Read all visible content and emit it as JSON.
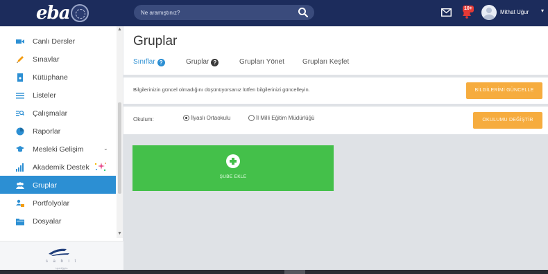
{
  "topbar": {
    "logo_text": "eba",
    "search_placeholder": "Ne aramıştınız?",
    "notification_badge": "10+",
    "username": "Mithat Uğur",
    "icons": [
      "search-icon",
      "mail-icon",
      "bell-icon",
      "avatar",
      "chevron-down-icon"
    ]
  },
  "sidebar": {
    "items": [
      {
        "label": "Canlı Dersler",
        "icon": "video-camera-icon",
        "color": "#2c8fd3"
      },
      {
        "label": "Sınavlar",
        "icon": "pencil-icon",
        "color": "#f39c12"
      },
      {
        "label": "Kütüphane",
        "icon": "book-icon",
        "color": "#2c8fd3"
      },
      {
        "label": "Listeler",
        "icon": "list-icon",
        "color": "#2c8fd3"
      },
      {
        "label": "Çalışmalar",
        "icon": "search-list-icon",
        "color": "#2c8fd3"
      },
      {
        "label": "Raporlar",
        "icon": "pie-chart-icon",
        "color": "#2c8fd3"
      },
      {
        "label": "Mesleki Gelişim",
        "icon": "graduation-cap-icon",
        "color": "#2c8fd3"
      },
      {
        "label": "Akademik Destek",
        "icon": "bar-chart-icon",
        "color": "#2c8fd3"
      },
      {
        "label": "Gruplar",
        "icon": "users-icon",
        "color": "#ffffff"
      },
      {
        "label": "Portfolyolar",
        "icon": "user-folder-icon",
        "color": "#2c8fd3"
      },
      {
        "label": "Dosyalar",
        "icon": "folder-icon",
        "color": "#2c8fd3"
      }
    ],
    "active_item": "Gruplar",
    "footer_text": "s a b i t",
    "footer_sub": "işbirliğiyle"
  },
  "main": {
    "title": "Gruplar",
    "tabs": [
      {
        "label": "Sınıflar",
        "active": true,
        "help": true
      },
      {
        "label": "Gruplar",
        "active": false,
        "help": true
      },
      {
        "label": "Grupları Yönet",
        "active": false,
        "help": false
      },
      {
        "label": "Grupları Keşfet",
        "active": false,
        "help": false
      }
    ],
    "info_text": "Bilgilerinizin güncel olmadığını düşünüyorsanız lütfen bilgilerinizi güncelleyin.",
    "update_button": "BİLGİLERİMİ GÜNCELLE",
    "school_label": "Okulum:",
    "school_options": [
      {
        "label": "İlyaslı Ortaokulu",
        "selected": true
      },
      {
        "label": "İl Milli Eğitim Müdürlüğü",
        "selected": false
      }
    ],
    "change_school_button": "OKULUMU DEĞİŞTİR",
    "add_card_label": "ŞUBE EKLE",
    "colors": {
      "accent": "#2c8fd3",
      "topbar": "#1c2c5c",
      "orange_button": "#f6ac3e",
      "add_card": "#44c04a"
    }
  }
}
